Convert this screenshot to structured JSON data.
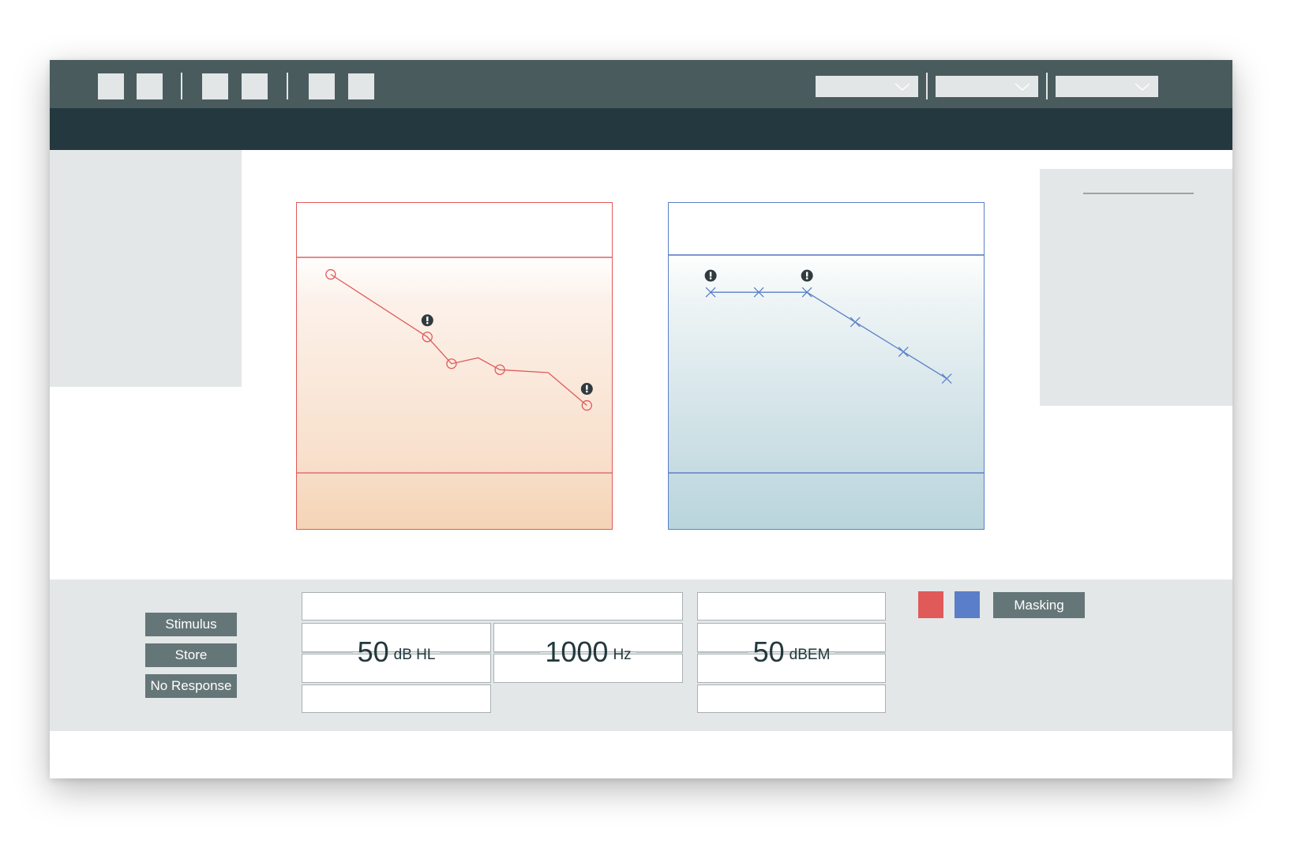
{
  "toolbar": {
    "buttons": [
      "tool-1",
      "tool-2",
      "tool-3",
      "tool-4",
      "tool-5",
      "tool-6"
    ],
    "dropdowns": [
      {
        "value": "",
        "icon": "chevron-down-icon"
      },
      {
        "value": "",
        "icon": "chevron-down-icon"
      },
      {
        "value": "",
        "icon": "chevron-down-icon"
      }
    ]
  },
  "commands": {
    "stimulus": "Stimulus",
    "store": "Store",
    "no_response": "No Response",
    "masking": "Masking"
  },
  "readouts": {
    "level_value": "50",
    "level_unit": "dB HL",
    "frequency_value": "1000",
    "frequency_unit": "Hz",
    "masking_value": "50",
    "masking_unit": "dBEM"
  },
  "colors": {
    "right_ear": "#e05a5a",
    "left_ear": "#5a7fc8",
    "toolbar": "#4a5b5e",
    "subbar": "#24393f",
    "panel": "#e4e7e7",
    "button": "#657678"
  },
  "chart_data": [
    {
      "type": "line",
      "name": "",
      "marker": "circle",
      "color": "#e05a5a",
      "x": [
        1,
        3,
        3.5,
        4.5,
        6.3
      ],
      "y": [
        14,
        35,
        44,
        46,
        58
      ],
      "bends": [
        {
          "x": 4.05,
          "y": 42
        },
        {
          "x": 5.5,
          "y": 47
        }
      ],
      "warnings_at": [
        1,
        4
      ],
      "xlim": [
        0.3,
        6.85
      ],
      "ylim": [
        -10,
        100
      ],
      "title": "",
      "xlabel": "",
      "ylabel": ""
    },
    {
      "type": "line",
      "name": "",
      "marker": "cross",
      "color": "#5a7fc8",
      "x": [
        1,
        2,
        3,
        4,
        5,
        5.9
      ],
      "y": [
        20,
        20,
        20,
        30,
        40,
        49
      ],
      "warnings_at": [
        0,
        2
      ],
      "xlim": [
        0.13,
        6.7
      ],
      "ylim": [
        -10,
        100
      ],
      "title": "",
      "xlabel": "",
      "ylabel": ""
    }
  ]
}
